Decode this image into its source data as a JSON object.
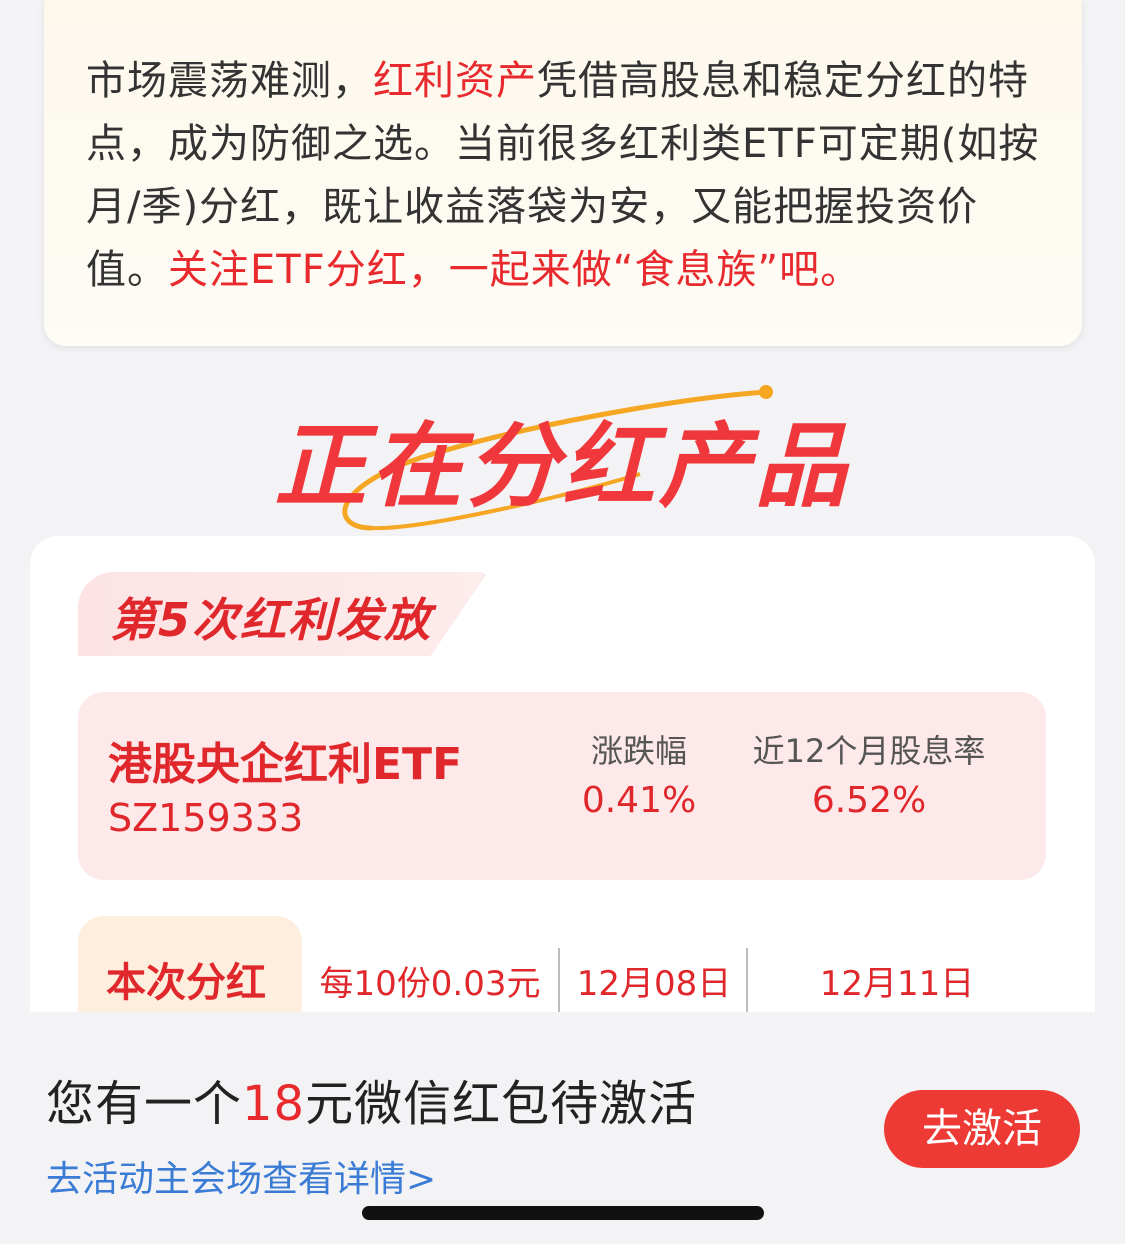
{
  "intro": {
    "part1": "市场震荡难测，",
    "highlight1": "红利资产",
    "part2": "凭借高股息和稳定分红的特点，成为防御之选。当前很多红利类ETF可定期(如按月/季)分红，既让收益落袋为安，又能把握投资价值。",
    "highlight2": "关注ETF分红，一起来做“食息族”吧。"
  },
  "section_title": "正在分红产品",
  "card": {
    "tag": "第5次红利发放",
    "fund_name": "港股央企红利ETF",
    "fund_code": "SZ159333",
    "change_label": "涨跌幅",
    "change_value": "0.41%",
    "yield_label": "近12个月股息率",
    "yield_value": "6.52%",
    "dividend_tag": "本次分红",
    "dividend_amount": "每10份0.03元",
    "date1": "12月08日",
    "date2": "12月11日"
  },
  "promo": {
    "prefix": "您有一个",
    "amount": "18",
    "suffix": "元微信红包待激活",
    "link": "去活动主会场查看详情>",
    "button": "去激活"
  },
  "colors": {
    "accent": "#e8292d",
    "link": "#3a7bd5",
    "button": "#ee3a34"
  }
}
